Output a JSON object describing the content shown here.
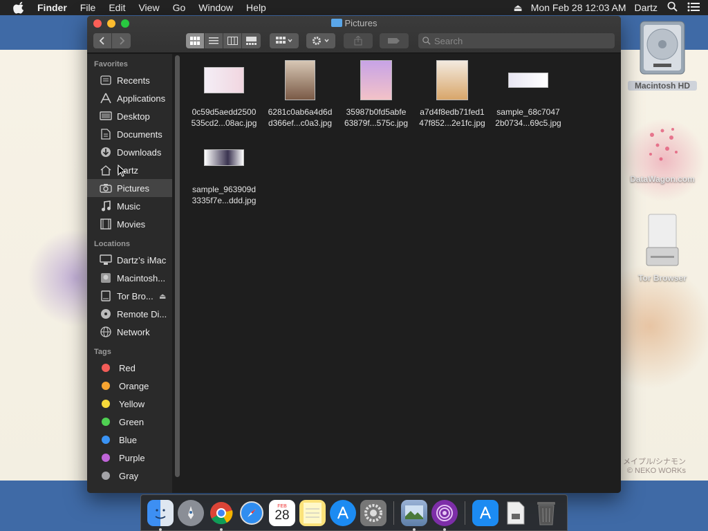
{
  "menubar": {
    "app_name": "Finder",
    "items": [
      "File",
      "Edit",
      "View",
      "Go",
      "Window",
      "Help"
    ],
    "datetime": "Mon Feb 28  12:03 AM",
    "user": "Dartz"
  },
  "desktop": {
    "icons": [
      {
        "label": "Macintosh HD",
        "icon": "hard-drive-icon"
      },
      {
        "label": "DataWagon.com",
        "icon": "image-file-icon"
      },
      {
        "label": "Tor Browser",
        "icon": "disk-image-icon"
      }
    ],
    "watermark_line1": "メイプル/シナモン",
    "watermark_line2": "© NEKO WORKs"
  },
  "window": {
    "title": "Pictures",
    "search_placeholder": "Search"
  },
  "sidebar": {
    "favorites_heading": "Favorites",
    "favorites": [
      {
        "label": "Recents",
        "icon": "recents-icon"
      },
      {
        "label": "Applications",
        "icon": "applications-icon"
      },
      {
        "label": "Desktop",
        "icon": "desktop-icon"
      },
      {
        "label": "Documents",
        "icon": "documents-icon"
      },
      {
        "label": "Downloads",
        "icon": "downloads-icon"
      },
      {
        "label": "Dartz",
        "icon": "home-icon"
      },
      {
        "label": "Pictures",
        "icon": "camera-icon",
        "selected": true
      },
      {
        "label": "Music",
        "icon": "music-icon"
      },
      {
        "label": "Movies",
        "icon": "movies-icon"
      }
    ],
    "locations_heading": "Locations",
    "locations": [
      {
        "label": "Dartz’s iMac",
        "icon": "computer-icon"
      },
      {
        "label": "Macintosh...",
        "icon": "hard-drive-icon"
      },
      {
        "label": "Tor Bro...",
        "icon": "drive-icon",
        "eject": "⏏"
      },
      {
        "label": "Remote Di...",
        "icon": "disc-icon"
      },
      {
        "label": "Network",
        "icon": "network-icon"
      }
    ],
    "tags_heading": "Tags",
    "tags": [
      {
        "label": "Red",
        "color": "#f25c58"
      },
      {
        "label": "Orange",
        "color": "#f6a431"
      },
      {
        "label": "Yellow",
        "color": "#f7d93a"
      },
      {
        "label": "Green",
        "color": "#4fd052"
      },
      {
        "label": "Blue",
        "color": "#3a93f4"
      },
      {
        "label": "Purple",
        "color": "#c065d9"
      },
      {
        "label": "Gray",
        "color": "#a3a3a7"
      }
    ]
  },
  "files": [
    {
      "line1": "0c59d5aedd2500",
      "line2": "535cd2...08ac.jpg",
      "shape": "wide"
    },
    {
      "line1": "6281c0ab6a4d6d",
      "line2": "d366ef...c0a3.jpg",
      "shape": "tall"
    },
    {
      "line1": "35987b0fd5abfe",
      "line2": "63879f...575c.jpg",
      "shape": "tall"
    },
    {
      "line1": "a7d4f8edb71fed1",
      "line2": "47f852...2e1fc.jpg",
      "shape": "tall"
    },
    {
      "line1": "sample_68c7047",
      "line2": "2b0734...69c5.jpg",
      "shape": "strip"
    },
    {
      "line1": "sample_963909d",
      "line2": "3335f7e...ddd.jpg",
      "shape": "strip"
    }
  ],
  "dock": {
    "apps": [
      "finder-icon",
      "launchpad-icon",
      "chrome-icon",
      "safari-icon",
      "calendar-icon",
      "notes-icon",
      "app-store-icon",
      "system-preferences-icon",
      "preview-icon",
      "tor-icon",
      "app-store-icon",
      "file-icon",
      "trash-icon"
    ],
    "calendar_month": "FEB",
    "calendar_day": "28"
  }
}
